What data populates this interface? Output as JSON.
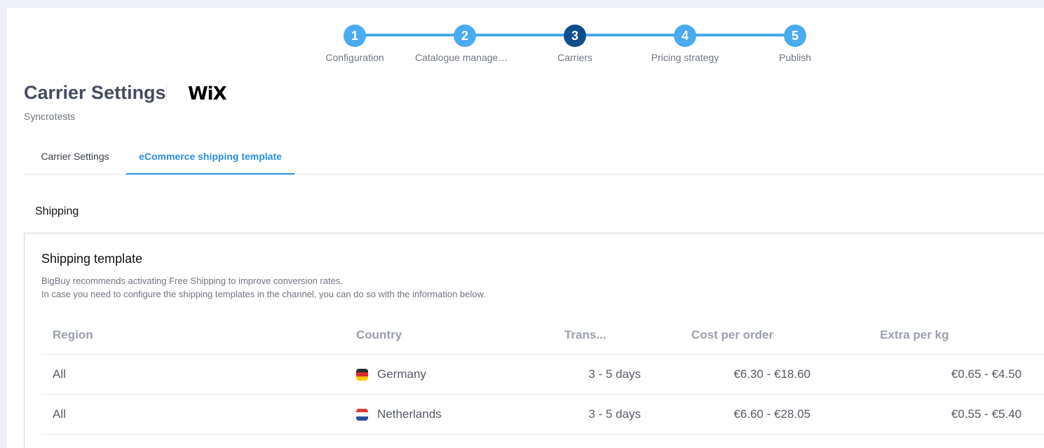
{
  "stepper": {
    "steps": [
      {
        "number": "1",
        "label": "Configuration",
        "state": "done"
      },
      {
        "number": "2",
        "label": "Catalogue management",
        "state": "done"
      },
      {
        "number": "3",
        "label": "Carriers",
        "state": "active"
      },
      {
        "number": "4",
        "label": "Pricing strategy",
        "state": "pending"
      },
      {
        "number": "5",
        "label": "Publish",
        "state": "pending"
      }
    ],
    "colors": {
      "step": "#4aabf0",
      "active": "#0d4e8c",
      "line": "#4aa8e8"
    }
  },
  "header": {
    "title": "Carrier Settings",
    "logo_text": "WiX",
    "subtitle": "Syncrotests"
  },
  "tabs": [
    {
      "label": "Carrier Settings",
      "active": false
    },
    {
      "label": "eCommerce shipping template",
      "active": true
    }
  ],
  "shipping": {
    "section_label": "Shipping",
    "panel_title": "Shipping template",
    "desc_line1": "BigBuy recommends activating Free Shipping to improve conversion rates.",
    "desc_line2": "In case you need to configure the shipping templates in the channel, you can do so with the information below."
  },
  "table": {
    "headers": {
      "region": "Region",
      "country": "Country",
      "transit": "Trans...",
      "cost": "Cost per order",
      "extra": "Extra per kg"
    },
    "rows": [
      {
        "region": "All",
        "country": "Germany",
        "flag_icon": "germany-flag-icon",
        "transit": "3 - 5 days",
        "cost": "€6.30 - €18.60",
        "extra": "€0.65 - €4.50"
      },
      {
        "region": "All",
        "country": "Netherlands",
        "flag_icon": "netherlands-flag-icon",
        "transit": "3 - 5 days",
        "cost": "€6.60 - €28.05",
        "extra": "€0.55 - €5.40"
      }
    ]
  }
}
